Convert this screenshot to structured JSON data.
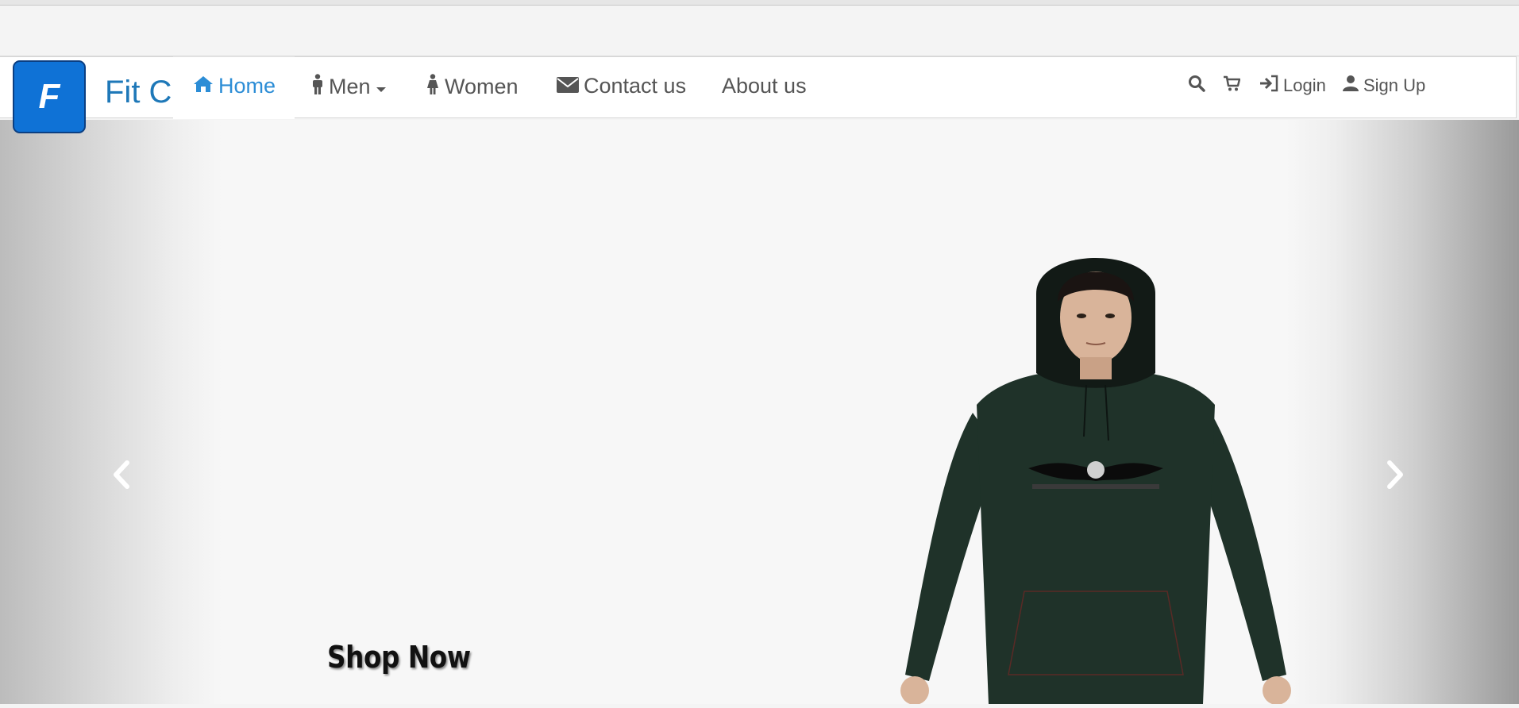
{
  "brand": {
    "logo_letter": "F",
    "name": "Fit C",
    "color": "#0f72d6"
  },
  "nav": {
    "items": [
      {
        "label": "Home",
        "icon": "home-icon",
        "active": true
      },
      {
        "label": "Men",
        "icon": "male-icon",
        "dropdown": true
      },
      {
        "label": "Women",
        "icon": "female-icon"
      },
      {
        "label": "Contact us",
        "icon": "envelope-icon"
      },
      {
        "label": "About us"
      }
    ],
    "right": {
      "search_icon": "search-icon",
      "cart_icon": "cart-icon",
      "login": {
        "label": "Login",
        "icon": "login-icon"
      },
      "signup": {
        "label": "Sign Up",
        "icon": "user-icon"
      }
    },
    "active_color": "#2c8dd6",
    "text_color": "#555555"
  },
  "carousel": {
    "cta": "Shop Now",
    "prev_icon": "chevron-left-icon",
    "next_icon": "chevron-right-icon",
    "hoodie_color": "#1f3229"
  }
}
